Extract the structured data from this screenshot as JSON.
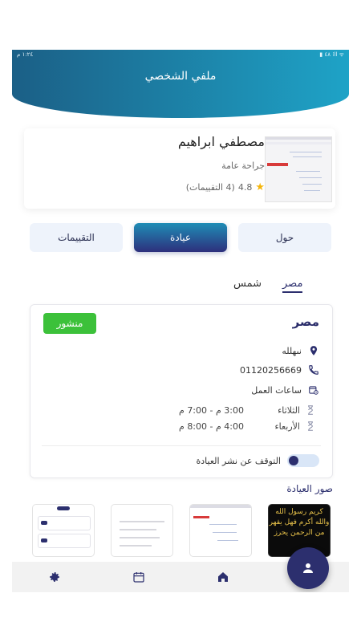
{
  "status_bar": {
    "time": "١:٢٤ م",
    "indicators": "▮ ٤٨ ⁞ll ᯤ"
  },
  "header": {
    "title": "ملفي الشخصي"
  },
  "profile": {
    "name": "مصطفي ابراهيم",
    "specialty": "جراحة عامة",
    "rating": "4.8",
    "reviews_text": "(4 التقييمات)"
  },
  "tabs": [
    {
      "label": "التقييمات"
    },
    {
      "label": "عيادة"
    },
    {
      "label": "حول"
    }
  ],
  "clinic_tabs": [
    {
      "label": "مصر"
    },
    {
      "label": "شمس"
    }
  ],
  "clinic": {
    "name": "مصر",
    "status_badge": "منشور",
    "address": "نىهلله",
    "phone": "01120256669",
    "hours_label": "ساعات العمل",
    "schedule": [
      {
        "day": "الثلاثاء",
        "time": "3:00 م - 7:00 م"
      },
      {
        "day": "الأربعاء",
        "time": "4:00 م - 8:00 م"
      }
    ],
    "stop_publish_label": "التوقف عن نشر العيادة"
  },
  "gallery": {
    "title": "صور العيادة",
    "calligraphy": "كريم رسول الله والله أكرم فهل يقهر من الرحمن يحرز"
  },
  "colors": {
    "primary": "#2c2f6e",
    "accent": "#1ea3c7",
    "published": "#3cc13a"
  }
}
